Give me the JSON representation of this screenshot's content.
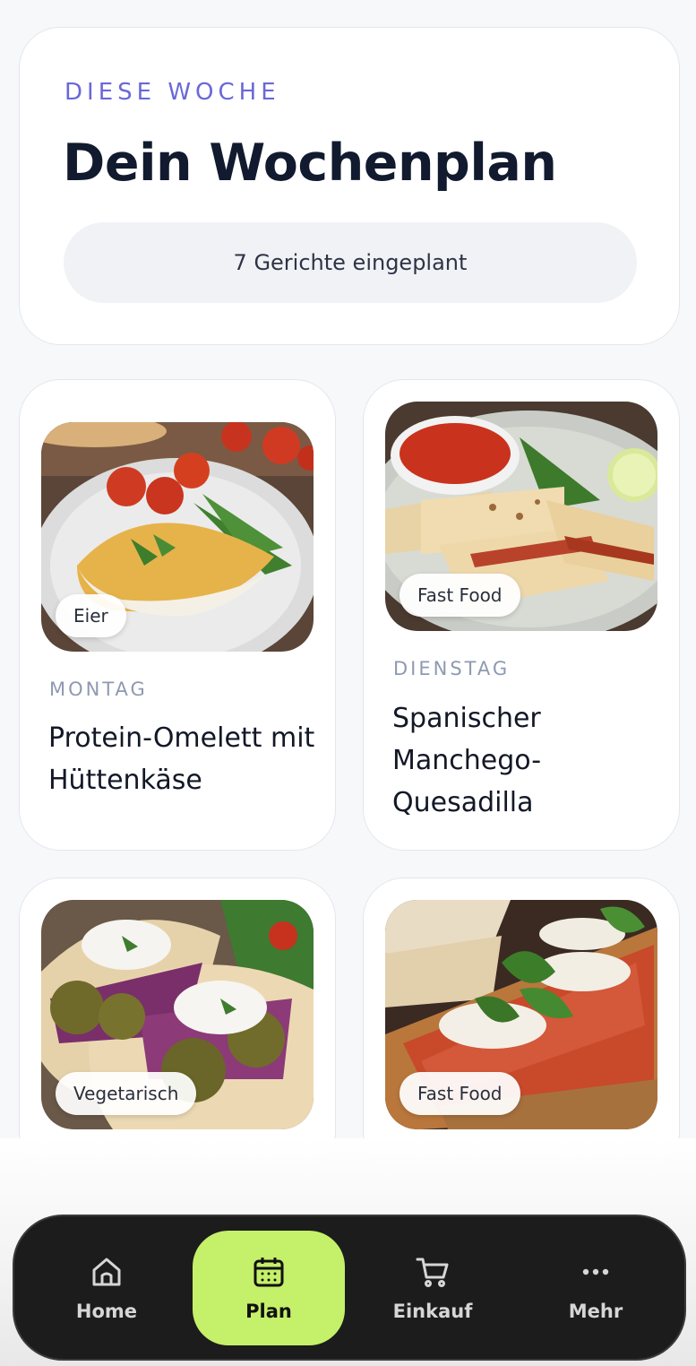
{
  "header": {
    "eyebrow": "DIESE WOCHE",
    "title": "Dein Wochenplan",
    "count_label": "7 Gerichte eingeplant"
  },
  "meals": [
    {
      "day": "MONTAG",
      "title": "Protein-Omelett mit Hüttenkäse",
      "tag": "Eier"
    },
    {
      "day": "DIENSTAG",
      "title": "Spanischer Manchego-Quesadilla",
      "tag": "Fast Food"
    },
    {
      "tag": "Vegetarisch"
    },
    {
      "tag": "Fast Food"
    }
  ],
  "nav": {
    "items": [
      {
        "label": "Home",
        "icon": "home-icon"
      },
      {
        "label": "Plan",
        "icon": "calendar-icon",
        "active": true
      },
      {
        "label": "Einkauf",
        "icon": "cart-icon"
      },
      {
        "label": "Mehr",
        "icon": "more-icon"
      }
    ]
  },
  "colors": {
    "accent": "#6a68d8",
    "nav_active": "#c5f06a",
    "nav_background": "#1c1c1d"
  }
}
